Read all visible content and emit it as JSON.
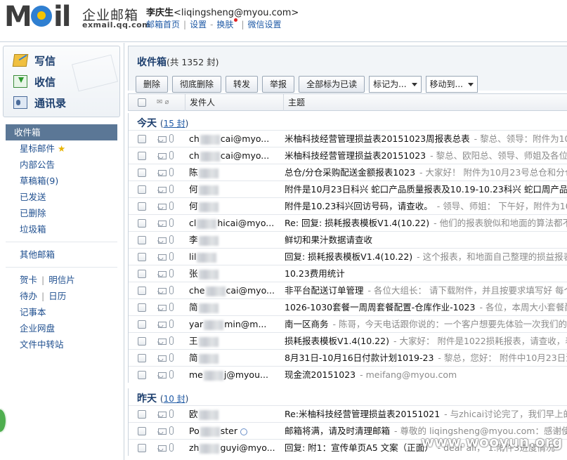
{
  "header": {
    "brand_cn": "企业邮箱",
    "brand_domain": "exmail.qq.com",
    "user_name": "李庆生",
    "user_email": "<liqingsheng@myou.com>",
    "links": [
      "邮箱首页",
      "设置",
      "换肤",
      "微信设置"
    ]
  },
  "sidebar": {
    "actions": [
      {
        "label": "写信",
        "icon": "compose-icon"
      },
      {
        "label": "收信",
        "icon": "inbox-download-icon"
      },
      {
        "label": "通讯录",
        "icon": "contacts-icon"
      }
    ],
    "folders": [
      {
        "label": "收件箱",
        "active": true
      },
      {
        "label": "星标邮件"
      },
      {
        "label": "内部公告"
      },
      {
        "label": "草稿箱(9)"
      },
      {
        "label": "已发送"
      },
      {
        "label": "已删除"
      },
      {
        "label": "垃圾箱"
      }
    ],
    "other_mailboxes": "其他邮箱",
    "tools": [
      [
        "贺卡",
        "明信片"
      ],
      [
        "待办",
        "日历"
      ]
    ],
    "extras": [
      "记事本",
      "企业网盘",
      "文件中转站"
    ]
  },
  "main": {
    "title": "收件箱",
    "count": "(共 1352 封)",
    "toolbar": {
      "delete": "删除",
      "delete_permanent": "彻底删除",
      "forward": "转发",
      "report": "举报",
      "mark_all_read": "全部标为已读",
      "mark_as": "标记为...",
      "move_to": "移动到..."
    },
    "columns": {
      "sender": "发件人",
      "subject": "主题"
    },
    "groups": [
      {
        "label": "今天",
        "count_prefix": "(",
        "count": "15 封",
        "count_suffix": ")",
        "rows": [
          {
            "sender_a": "ch",
            "sender_b": "cai@myo...",
            "subject": "米柚科技经营管理损益表20151023周报表总表",
            "preview": "- 黎总、领导：附件为102"
          },
          {
            "sender_a": "ch",
            "sender_b": "cai@myo...",
            "subject": "米柚科技经营管理损益表20151023",
            "preview": "- 黎总、欧阳总、领导、师姐及各位大"
          },
          {
            "sender_a": "陈",
            "sender_b": "",
            "subject": "总仓/分仓采购配送金额报表1023",
            "preview": "- 大家好！ 附件为10月23号总仓和分仓采"
          },
          {
            "sender_a": "何",
            "sender_b": "",
            "subject": "附件是10月23日科兴  蛇口产品质量报表及10.19-10.23科兴 蛇口周产品质",
            "preview": ""
          },
          {
            "sender_a": "何",
            "sender_b": "",
            "subject": "附件是10.23科兴回访号码，请查收。",
            "preview": "- 领导、师姐：  下午好，附件为10.2"
          },
          {
            "sender_a": "cl",
            "sender_b": "hicai@myo...",
            "subject": "Re: 回复: 损耗报表模板V1.4(10.22)",
            "preview": "- 他们的报表貌似和地面的算法都不"
          },
          {
            "sender_a": "李",
            "sender_b": "",
            "subject": "鲜切和果汁数据请查收",
            "preview": ""
          },
          {
            "sender_a": "lil",
            "sender_b": "",
            "subject": "回复: 损耗报表模板V1.4(10.22)",
            "preview": "- 这个报表，和地面自己整理的损益报表有"
          },
          {
            "sender_a": "张",
            "sender_b": "",
            "subject": "10.23费用统计",
            "preview": ""
          },
          {
            "sender_a": "che",
            "sender_b": "cai@myo...",
            "subject": "非平台配送订单管理",
            "preview": "- 各位大组长：  请下载附件，并且按要求填写好 每个大"
          },
          {
            "sender_a": "简",
            "sender_b": "",
            "subject": "1026-1030套餐一周周套餐配置-仓库作业-1023",
            "preview": "- 各位，本周大小套餐配置"
          },
          {
            "sender_a": "yar",
            "sender_b": "min@m...",
            "subject": "南一区商务",
            "preview": "- 陈哥，今天电话跟你说的：一个客户想要先体验一次我们的水果"
          },
          {
            "sender_a": "王",
            "sender_b": "",
            "subject": "损耗报表模板V1.4(10.22)",
            "preview": "- 大家好：  附件是1022损耗报表，请查收，表中"
          },
          {
            "sender_a": "简",
            "sender_b": "",
            "subject": "8月31日-10月16日付款计划1019-23",
            "preview": "- 黎总，您好：  附件中10月23日沟通"
          },
          {
            "sender_a": "me",
            "sender_b": "j@myou...",
            "subject": "现金流20151023",
            "preview": "- meifang@myou.com"
          }
        ]
      },
      {
        "label": "昨天",
        "count_prefix": "(",
        "count": "10 封",
        "count_suffix": ")",
        "rows": [
          {
            "sender_a": "欧",
            "sender_b": "",
            "subject": "Re:米柚科技经营管理损益表20151021",
            "preview": "- 与zhicai讨论完了，我们早上的沟"
          },
          {
            "sender_a": "Po",
            "sender_b": "ster",
            "subject": "邮箱将满，请及时清理邮箱",
            "preview": "- 尊敬的 liqingsheng@myou.com：感谢使用"
          },
          {
            "sender_a": "zh",
            "sender_b": "guyi@myo...",
            "subject": "回复: 附1：宣传单页A5 文案（正面）",
            "preview": "- dear all，  1.附件3进度情况"
          }
        ]
      }
    ]
  },
  "watermark": "www.wooyun.org"
}
